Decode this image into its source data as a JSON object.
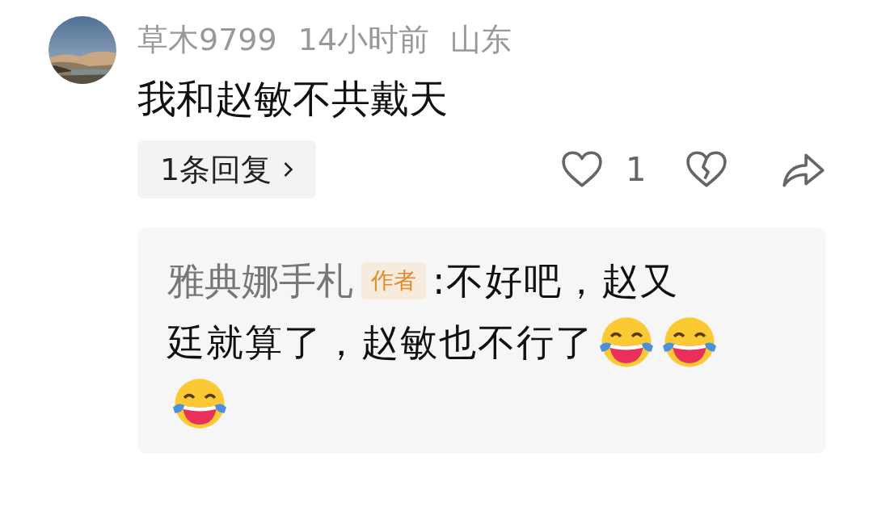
{
  "comment": {
    "username": "草木9799",
    "time": "14小时前",
    "location": "山东",
    "text": "我和赵敏不共戴天",
    "replies_button": "1条回复",
    "like_count": "1",
    "reply": {
      "author": "雅典娜手札",
      "badge": "作者",
      "text_lines": [
        ":不好吧，赵又",
        "廷就算了，赵敏也不行了"
      ]
    }
  }
}
